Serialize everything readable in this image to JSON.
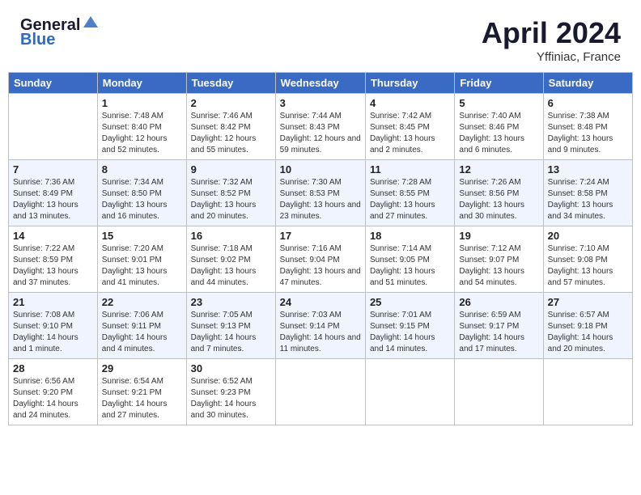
{
  "header": {
    "logo_line1": "General",
    "logo_line2": "Blue",
    "month": "April 2024",
    "location": "Yffiniac, France"
  },
  "days_of_week": [
    "Sunday",
    "Monday",
    "Tuesday",
    "Wednesday",
    "Thursday",
    "Friday",
    "Saturday"
  ],
  "weeks": [
    [
      {
        "day": "",
        "sunrise": "",
        "sunset": "",
        "daylight": ""
      },
      {
        "day": "1",
        "sunrise": "Sunrise: 7:48 AM",
        "sunset": "Sunset: 8:40 PM",
        "daylight": "Daylight: 12 hours and 52 minutes."
      },
      {
        "day": "2",
        "sunrise": "Sunrise: 7:46 AM",
        "sunset": "Sunset: 8:42 PM",
        "daylight": "Daylight: 12 hours and 55 minutes."
      },
      {
        "day": "3",
        "sunrise": "Sunrise: 7:44 AM",
        "sunset": "Sunset: 8:43 PM",
        "daylight": "Daylight: 12 hours and 59 minutes."
      },
      {
        "day": "4",
        "sunrise": "Sunrise: 7:42 AM",
        "sunset": "Sunset: 8:45 PM",
        "daylight": "Daylight: 13 hours and 2 minutes."
      },
      {
        "day": "5",
        "sunrise": "Sunrise: 7:40 AM",
        "sunset": "Sunset: 8:46 PM",
        "daylight": "Daylight: 13 hours and 6 minutes."
      },
      {
        "day": "6",
        "sunrise": "Sunrise: 7:38 AM",
        "sunset": "Sunset: 8:48 PM",
        "daylight": "Daylight: 13 hours and 9 minutes."
      }
    ],
    [
      {
        "day": "7",
        "sunrise": "Sunrise: 7:36 AM",
        "sunset": "Sunset: 8:49 PM",
        "daylight": "Daylight: 13 hours and 13 minutes."
      },
      {
        "day": "8",
        "sunrise": "Sunrise: 7:34 AM",
        "sunset": "Sunset: 8:50 PM",
        "daylight": "Daylight: 13 hours and 16 minutes."
      },
      {
        "day": "9",
        "sunrise": "Sunrise: 7:32 AM",
        "sunset": "Sunset: 8:52 PM",
        "daylight": "Daylight: 13 hours and 20 minutes."
      },
      {
        "day": "10",
        "sunrise": "Sunrise: 7:30 AM",
        "sunset": "Sunset: 8:53 PM",
        "daylight": "Daylight: 13 hours and 23 minutes."
      },
      {
        "day": "11",
        "sunrise": "Sunrise: 7:28 AM",
        "sunset": "Sunset: 8:55 PM",
        "daylight": "Daylight: 13 hours and 27 minutes."
      },
      {
        "day": "12",
        "sunrise": "Sunrise: 7:26 AM",
        "sunset": "Sunset: 8:56 PM",
        "daylight": "Daylight: 13 hours and 30 minutes."
      },
      {
        "day": "13",
        "sunrise": "Sunrise: 7:24 AM",
        "sunset": "Sunset: 8:58 PM",
        "daylight": "Daylight: 13 hours and 34 minutes."
      }
    ],
    [
      {
        "day": "14",
        "sunrise": "Sunrise: 7:22 AM",
        "sunset": "Sunset: 8:59 PM",
        "daylight": "Daylight: 13 hours and 37 minutes."
      },
      {
        "day": "15",
        "sunrise": "Sunrise: 7:20 AM",
        "sunset": "Sunset: 9:01 PM",
        "daylight": "Daylight: 13 hours and 41 minutes."
      },
      {
        "day": "16",
        "sunrise": "Sunrise: 7:18 AM",
        "sunset": "Sunset: 9:02 PM",
        "daylight": "Daylight: 13 hours and 44 minutes."
      },
      {
        "day": "17",
        "sunrise": "Sunrise: 7:16 AM",
        "sunset": "Sunset: 9:04 PM",
        "daylight": "Daylight: 13 hours and 47 minutes."
      },
      {
        "day": "18",
        "sunrise": "Sunrise: 7:14 AM",
        "sunset": "Sunset: 9:05 PM",
        "daylight": "Daylight: 13 hours and 51 minutes."
      },
      {
        "day": "19",
        "sunrise": "Sunrise: 7:12 AM",
        "sunset": "Sunset: 9:07 PM",
        "daylight": "Daylight: 13 hours and 54 minutes."
      },
      {
        "day": "20",
        "sunrise": "Sunrise: 7:10 AM",
        "sunset": "Sunset: 9:08 PM",
        "daylight": "Daylight: 13 hours and 57 minutes."
      }
    ],
    [
      {
        "day": "21",
        "sunrise": "Sunrise: 7:08 AM",
        "sunset": "Sunset: 9:10 PM",
        "daylight": "Daylight: 14 hours and 1 minute."
      },
      {
        "day": "22",
        "sunrise": "Sunrise: 7:06 AM",
        "sunset": "Sunset: 9:11 PM",
        "daylight": "Daylight: 14 hours and 4 minutes."
      },
      {
        "day": "23",
        "sunrise": "Sunrise: 7:05 AM",
        "sunset": "Sunset: 9:13 PM",
        "daylight": "Daylight: 14 hours and 7 minutes."
      },
      {
        "day": "24",
        "sunrise": "Sunrise: 7:03 AM",
        "sunset": "Sunset: 9:14 PM",
        "daylight": "Daylight: 14 hours and 11 minutes."
      },
      {
        "day": "25",
        "sunrise": "Sunrise: 7:01 AM",
        "sunset": "Sunset: 9:15 PM",
        "daylight": "Daylight: 14 hours and 14 minutes."
      },
      {
        "day": "26",
        "sunrise": "Sunrise: 6:59 AM",
        "sunset": "Sunset: 9:17 PM",
        "daylight": "Daylight: 14 hours and 17 minutes."
      },
      {
        "day": "27",
        "sunrise": "Sunrise: 6:57 AM",
        "sunset": "Sunset: 9:18 PM",
        "daylight": "Daylight: 14 hours and 20 minutes."
      }
    ],
    [
      {
        "day": "28",
        "sunrise": "Sunrise: 6:56 AM",
        "sunset": "Sunset: 9:20 PM",
        "daylight": "Daylight: 14 hours and 24 minutes."
      },
      {
        "day": "29",
        "sunrise": "Sunrise: 6:54 AM",
        "sunset": "Sunset: 9:21 PM",
        "daylight": "Daylight: 14 hours and 27 minutes."
      },
      {
        "day": "30",
        "sunrise": "Sunrise: 6:52 AM",
        "sunset": "Sunset: 9:23 PM",
        "daylight": "Daylight: 14 hours and 30 minutes."
      },
      {
        "day": "",
        "sunrise": "",
        "sunset": "",
        "daylight": ""
      },
      {
        "day": "",
        "sunrise": "",
        "sunset": "",
        "daylight": ""
      },
      {
        "day": "",
        "sunrise": "",
        "sunset": "",
        "daylight": ""
      },
      {
        "day": "",
        "sunrise": "",
        "sunset": "",
        "daylight": ""
      }
    ]
  ]
}
